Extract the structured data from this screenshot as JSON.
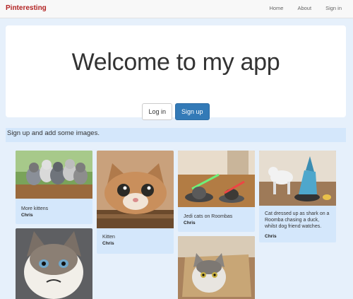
{
  "navbar": {
    "brand": "Pinteresting",
    "links": [
      "Home",
      "About",
      "Sign in"
    ]
  },
  "jumbotron": {
    "title": "Welcome to my app",
    "login_label": "Log in",
    "signup_label": "Sign up"
  },
  "notice": "Sign up and add some images.",
  "pins": [
    {
      "caption": "More kittens",
      "user": "Chris",
      "image": "kittens-on-log"
    },
    {
      "caption": "",
      "user": "",
      "image": "grumpy-cat"
    },
    {
      "caption": "Kitten",
      "user": "Chris",
      "image": "kitten-peeking"
    },
    {
      "caption": "Jedi cats on Roombas",
      "user": "Chris",
      "image": "jedi-cats-roomba"
    },
    {
      "caption": "",
      "user": "",
      "image": "cat-in-paper-bag"
    },
    {
      "caption": "Cat dressed up as shark on a Roomba chasing a duck, whilst dog friend watches.",
      "user": "Chris",
      "image": "shark-cat-roomba"
    }
  ],
  "colors": {
    "page_bg": "#e6f0fb",
    "card_bg": "#d4e7fb",
    "brand": "#b22222",
    "primary": "#337ab7"
  }
}
